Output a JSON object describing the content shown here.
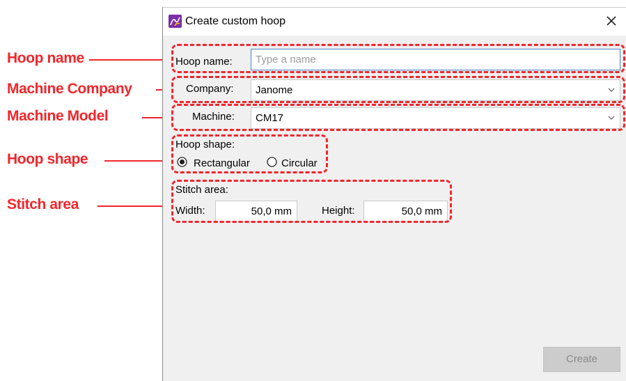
{
  "annotations": {
    "hoop_name": "Hoop name",
    "machine_company": "Machine Company",
    "machine_model": "Machine Model",
    "hoop_shape": "Hoop shape",
    "stitch_area": "Stitch area",
    "color": "#f0262b"
  },
  "dialog": {
    "title": "Create custom hoop",
    "close_icon": "close-icon",
    "hoop_name_label": "Hoop name:",
    "hoop_name_value": "",
    "hoop_name_placeholder": "Type a name",
    "company_label": "Company:",
    "company_value": "Janome",
    "machine_label": "Machine:",
    "machine_value": "CM17",
    "hoop_shape_label": "Hoop shape:",
    "shape_options": [
      {
        "label": "Rectangular",
        "selected": true
      },
      {
        "label": "Circular",
        "selected": false
      }
    ],
    "stitch_area_label": "Stitch area:",
    "width_label": "Width:",
    "width_value": "50,0 mm",
    "height_label": "Height:",
    "height_value": "50,0 mm",
    "create_button": "Create",
    "create_enabled": false
  }
}
